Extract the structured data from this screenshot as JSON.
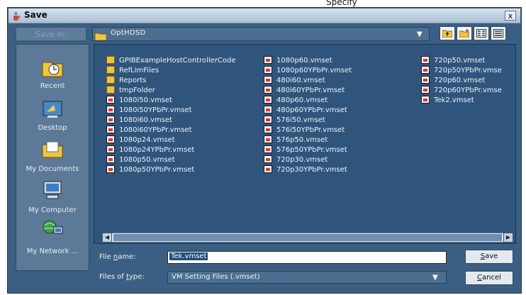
{
  "background_text": "Specify",
  "window": {
    "title": "Save",
    "close_label": "x"
  },
  "look_in": {
    "label": "Save In:",
    "value": "OptHDSD"
  },
  "places": [
    {
      "label": "Recent",
      "icon": "recent-icon"
    },
    {
      "label": "Desktop",
      "icon": "desktop-icon"
    },
    {
      "label": "My Documents",
      "icon": "my-documents-icon"
    },
    {
      "label": "My Computer",
      "icon": "my-computer-icon"
    },
    {
      "label": "My Network ...",
      "icon": "my-network-icon"
    }
  ],
  "files": {
    "col1": [
      {
        "name": "GPIBExampleHostControllerCode",
        "type": "folder"
      },
      {
        "name": "RefLimFiles",
        "type": "folder"
      },
      {
        "name": "Reports",
        "type": "folder"
      },
      {
        "name": "tmpFolder",
        "type": "folder"
      },
      {
        "name": "1080i50.vmset",
        "type": "file"
      },
      {
        "name": "1080i50YPbPr.vmset",
        "type": "file"
      },
      {
        "name": "1080i60.vmset",
        "type": "file"
      },
      {
        "name": "1080i60YPbPr.vmset",
        "type": "file"
      },
      {
        "name": "1080p24.vmset",
        "type": "file"
      },
      {
        "name": "1080p24YPbPr.vmset",
        "type": "file"
      },
      {
        "name": "1080p50.vmset",
        "type": "file"
      },
      {
        "name": "1080p50YPbPr.vmset",
        "type": "file"
      }
    ],
    "col2": [
      {
        "name": "1080p60.vmset",
        "type": "file"
      },
      {
        "name": "1080p60YPbPr.vmset",
        "type": "file"
      },
      {
        "name": "480i60.vmset",
        "type": "file"
      },
      {
        "name": "480i60YPbPr.vmset",
        "type": "file"
      },
      {
        "name": "480p60.vmset",
        "type": "file"
      },
      {
        "name": "480p60YPbPr.vmset",
        "type": "file"
      },
      {
        "name": "576i50.vmset",
        "type": "file"
      },
      {
        "name": "576i50YPbPr.vmset",
        "type": "file"
      },
      {
        "name": "576p50.vmset",
        "type": "file"
      },
      {
        "name": "576p50YPbPr.vmset",
        "type": "file"
      },
      {
        "name": "720p30.vmset",
        "type": "file"
      },
      {
        "name": "720p30YPbPr.vmset",
        "type": "file"
      }
    ],
    "col3": [
      {
        "name": "720p50.vmset",
        "type": "file"
      },
      {
        "name": "720p50YPbPr.vmse",
        "type": "file"
      },
      {
        "name": "720p60.vmset",
        "type": "file"
      },
      {
        "name": "720p60YPbPr.vmse",
        "type": "file"
      },
      {
        "name": "Tek2.vmset",
        "type": "file"
      }
    ]
  },
  "file_name": {
    "label_pre": "File ",
    "label_u": "n",
    "label_post": "ame:",
    "value": "Tek.vmset"
  },
  "file_type": {
    "label_pre": "Files of ",
    "label_u": "t",
    "label_post": "ype:",
    "value": "VM Setting Files (.vmset)"
  },
  "buttons": {
    "save_u": "S",
    "save_rest": "ave",
    "cancel_u": "C",
    "cancel_rest": "ancel"
  },
  "colors": {
    "dialog_bg": "#3a5f82",
    "list_bg": "#2f557d",
    "folder": "#f2c43e"
  }
}
